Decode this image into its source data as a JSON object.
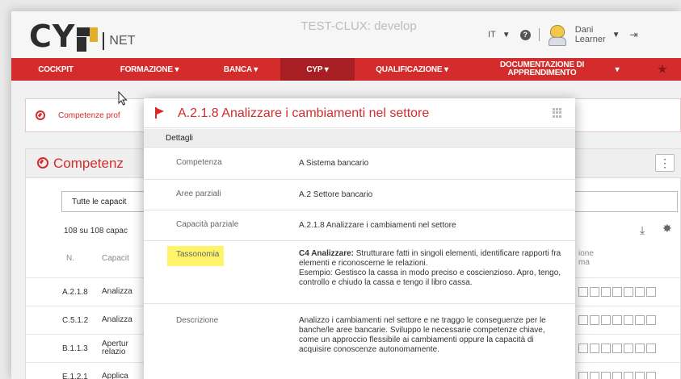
{
  "app": {
    "logo_text": "CY",
    "logo_suffix": "NET",
    "env_title": "TEST-CLUX: develop"
  },
  "header": {
    "lang": "IT",
    "help_icon": "help-icon",
    "user_first": "Dani",
    "user_last": "Learner",
    "logout_icon": "logout-icon"
  },
  "nav": {
    "items": [
      {
        "label": "COCKPIT"
      },
      {
        "label": "FORMAZIONE ▾"
      },
      {
        "label": "BANCA ▾"
      },
      {
        "label": "CYP ▾"
      },
      {
        "label": "QUALIFICAZIONE ▾"
      },
      {
        "label": "DOCUMENTAZIONE DI",
        "label2": "APPRENDIMENTO"
      }
    ],
    "doc_caret": "▾",
    "active_color": "#a71f22"
  },
  "crumb": {
    "text": "Competenze prof"
  },
  "section": {
    "title": "Competenz",
    "filter_value": "Tutte le capacit",
    "count": "108 su 108 capac",
    "col_n": "N.",
    "col_cap": "Capacit",
    "col_cerchio1": "ione",
    "col_cerchio2": "ma",
    "rows": [
      {
        "code": "A.2.1.8",
        "name": "Analizza"
      },
      {
        "code": "C.5.1.2",
        "name": "Analizza"
      },
      {
        "code": "B.1.1.3",
        "name": "Apertur",
        "name2": "relazio"
      },
      {
        "code": "E.1.2.1",
        "name": "Applica"
      }
    ]
  },
  "modal": {
    "title": "A.2.1.8 Analizzare i cambiamenti nel settore",
    "subhead": "Dettagli",
    "fields": [
      {
        "label": "Competenza",
        "value": "A Sistema bancario"
      },
      {
        "label": "Aree parziali",
        "value": "A.2 Settore bancario"
      },
      {
        "label": "Capacità parziale",
        "value": "A.2.1.8 Analizzare i cambiamenti nel settore"
      },
      {
        "label": "Tassonomia",
        "value_bold": "C4 Analizzare:",
        "value": "Strutturare fatti in singoli elementi, identificare rapporti fra elementi e riconoscerne le relazioni.",
        "value2": "Esempio: Gestisco la cassa in modo preciso e coscienzioso. Apro, tengo, controllo e chiudo la cassa e tengo il libro cassa."
      },
      {
        "label": "Descrizione",
        "value": "Analizzo i cambiamenti nel settore e ne traggo le conseguenze per le banche/le aree bancarie. Sviluppo le necessarie competenze chiave, come un approccio flessibile ai cambiamenti oppure la capacità di acquisire conoscenze autonomamente."
      }
    ]
  },
  "colors": {
    "brand_red": "#d42c2c",
    "highlight": "#fff36a",
    "logo_accent": "#e3ae2a"
  }
}
